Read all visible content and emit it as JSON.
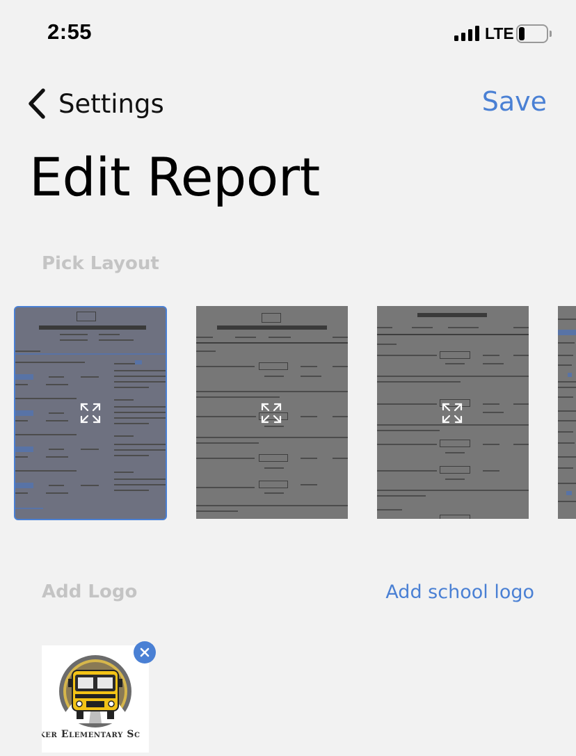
{
  "status_bar": {
    "time": "2:55",
    "network": "LTE",
    "signal_icon": "cellular-signal-icon",
    "battery_icon": "battery-low-icon",
    "battery_level": 0.15
  },
  "nav": {
    "back_label": "Settings",
    "back_icon": "chevron-left-icon",
    "save_label": "Save"
  },
  "page": {
    "title": "Edit Report"
  },
  "layout_section": {
    "label": "Pick Layout",
    "selected_index": 0,
    "layouts": [
      {
        "name": "layout-a",
        "selected": true
      },
      {
        "name": "layout-b",
        "selected": false
      },
      {
        "name": "layout-c",
        "selected": false
      },
      {
        "name": "layout-d",
        "selected": false
      }
    ],
    "expand_icon": "expand-arrows-icon"
  },
  "logo_section": {
    "label": "Add Logo",
    "add_link": "Add school logo",
    "logo_caption": "ker Elementary Sc",
    "remove_icon": "close-icon"
  },
  "colors": {
    "accent": "#4a80d4",
    "background": "#f2f2f2",
    "section_label": "#c4c4c4",
    "bus_yellow": "#f3c316",
    "logo_ring": "#6b6b6b"
  }
}
